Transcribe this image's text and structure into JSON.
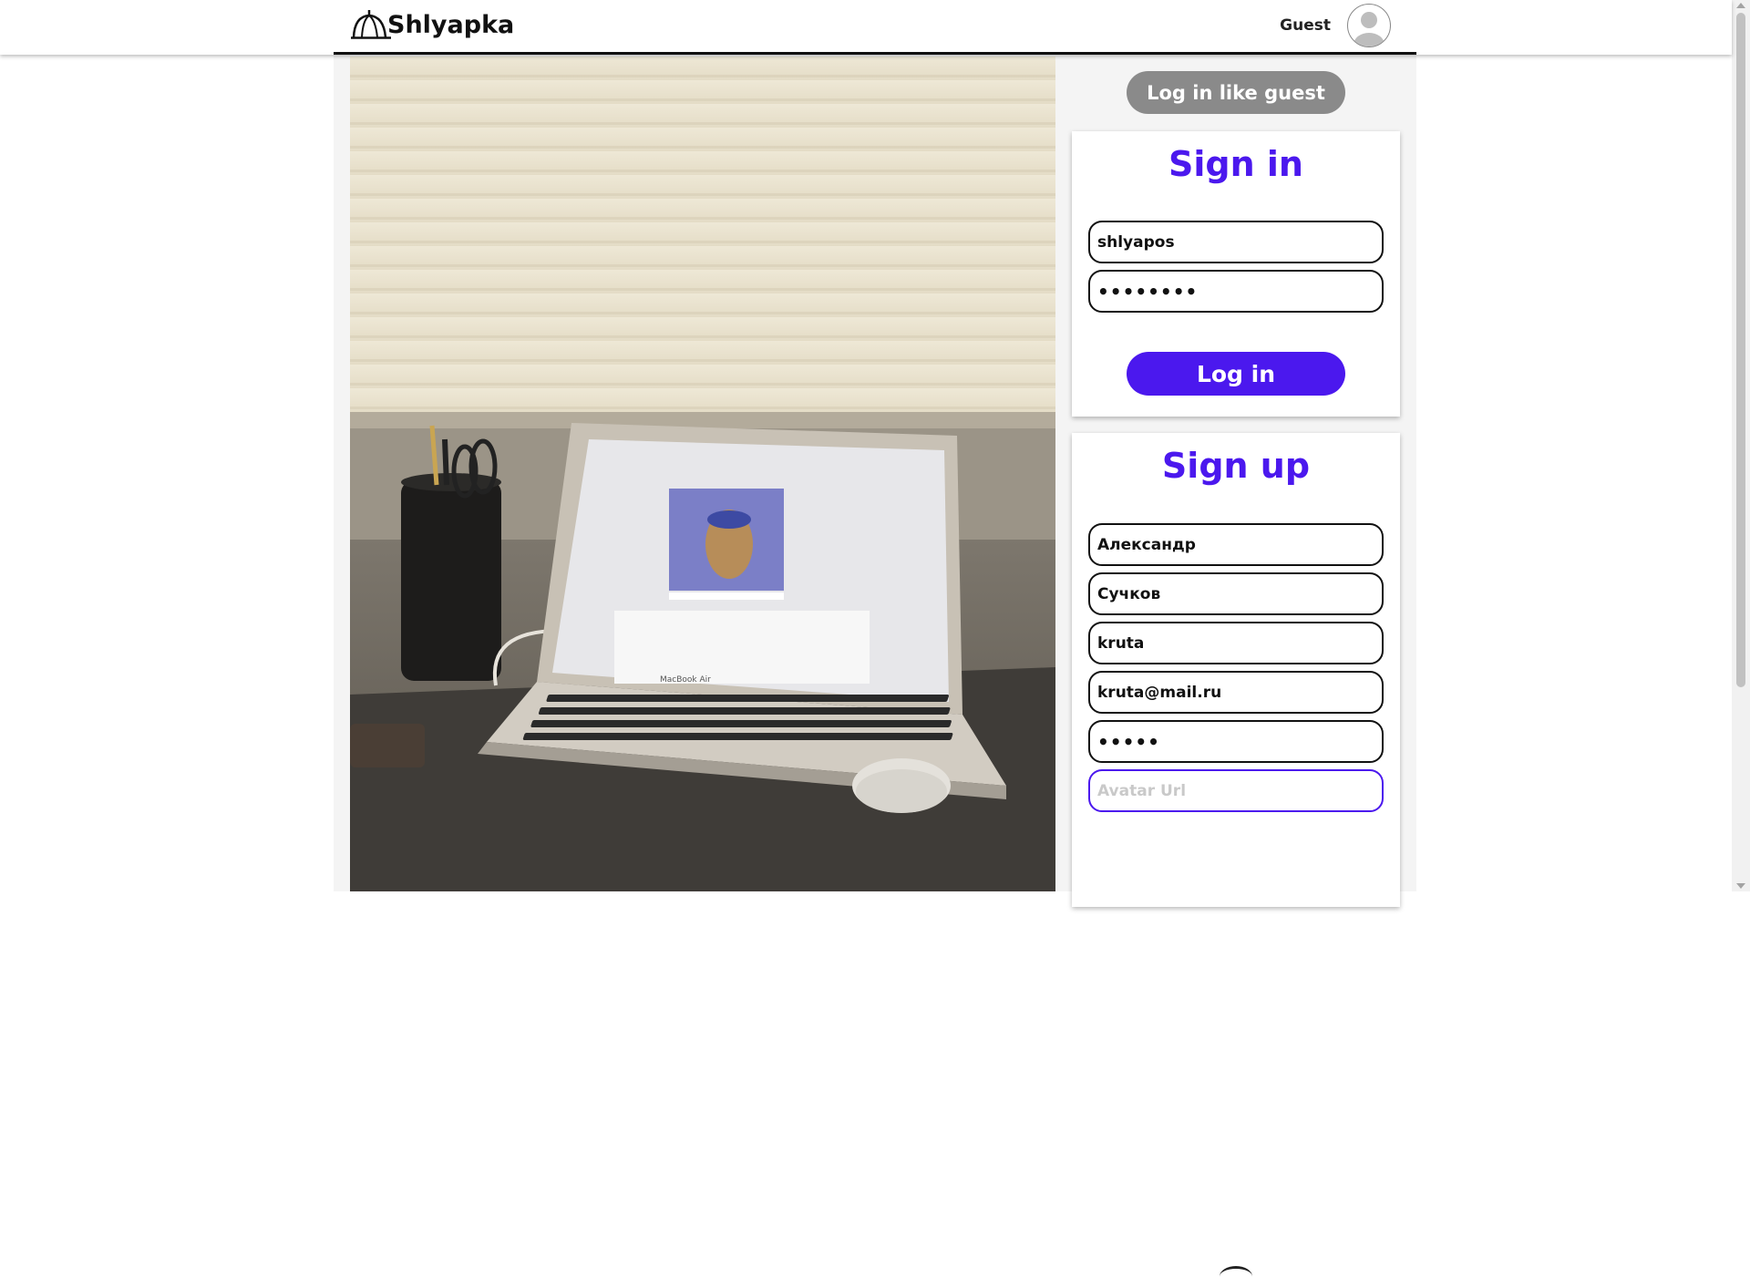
{
  "header": {
    "logo_text": "Shlyapka",
    "user_name": "Guest"
  },
  "hero": {
    "laptop_brand_text": "MacBook Air"
  },
  "auth": {
    "guest_button_label": "Log in like guest",
    "sign_in": {
      "title": "Sign in",
      "login_value": "shlyapos",
      "password_value": "password",
      "submit_label": "Log in"
    },
    "sign_up": {
      "title": "Sign up",
      "first_name_value": "Александр",
      "last_name_value": "Сучков",
      "username_value": "kruta",
      "email_value": "kruta@mail.ru",
      "password_value": "12345",
      "avatar_url_value": "",
      "avatar_url_placeholder": "Avatar Url"
    }
  },
  "colors": {
    "accent": "#4b18ee",
    "guest_button": "#8a8a8a",
    "panel_background": "#f4f4f4"
  }
}
